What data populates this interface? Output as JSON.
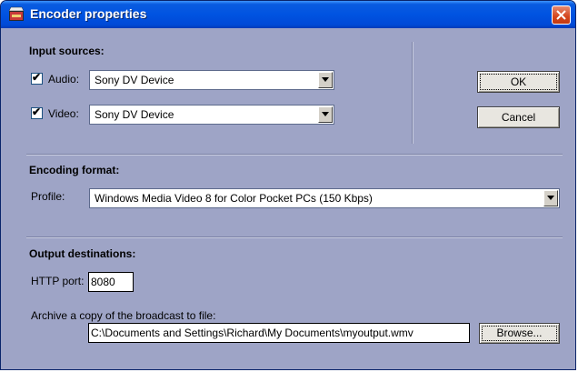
{
  "window": {
    "title": "Encoder properties"
  },
  "input_sources": {
    "heading": "Input sources:",
    "audio": {
      "checked": true,
      "label": "Audio:",
      "device": "Sony DV Device"
    },
    "video": {
      "checked": true,
      "label": "Video:",
      "device": "Sony DV Device"
    }
  },
  "buttons": {
    "ok": "OK",
    "cancel": "Cancel",
    "browse": "Browse..."
  },
  "encoding_format": {
    "heading": "Encoding format:",
    "profile_label": "Profile:",
    "profile_value": "Windows Media Video 8 for Color Pocket PCs (150 Kbps)"
  },
  "output_destinations": {
    "heading": "Output destinations:",
    "http_port_label": "HTTP port:",
    "http_port_value": "8080",
    "archive_label": "Archive a copy of the broadcast to file:",
    "archive_path": "C:\\Documents and Settings\\Richard\\My Documents\\myoutput.wmv"
  },
  "check_mark": "✔",
  "icons": {
    "title": "encoder-app-icon",
    "close": "close-icon",
    "dropdown": "chevron-down-icon"
  },
  "colors": {
    "dialog_bg": "#9ea4c6",
    "titlebar": "#0053e1",
    "close": "#d4451c"
  }
}
